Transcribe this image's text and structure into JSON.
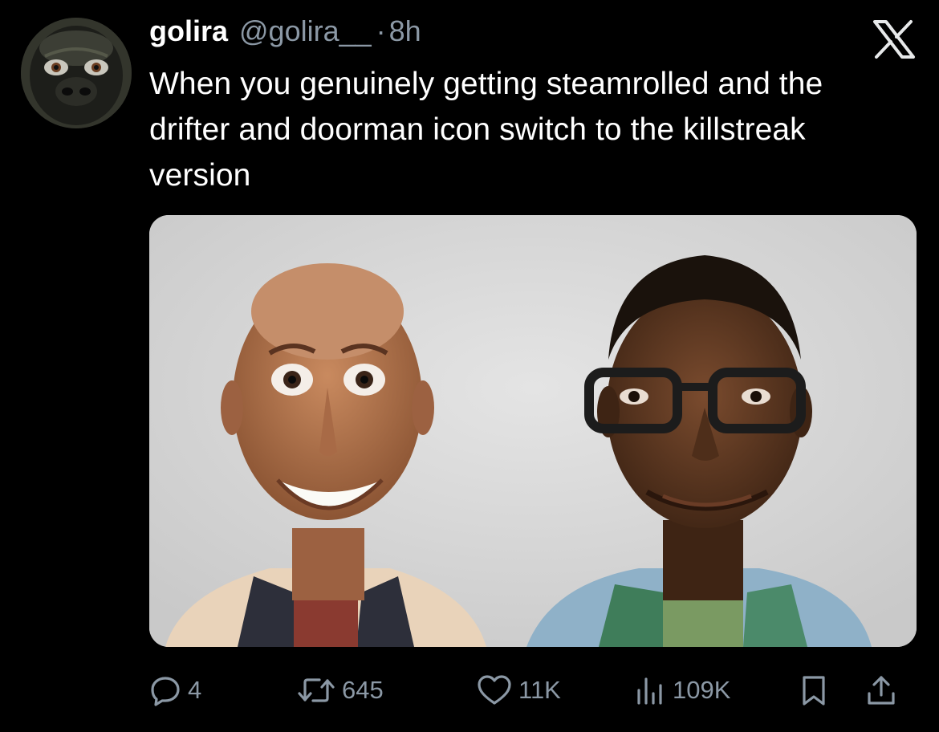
{
  "tweet": {
    "display_name": "golira",
    "handle": "@golira__",
    "separator": "·",
    "time": "8h",
    "text": "When you genuinely getting steamrolled and the drifter and doorman icon switch to the killstreak version"
  },
  "actions": {
    "replies": "4",
    "retweets": "645",
    "likes": "11K",
    "views": "109K"
  },
  "icons": {
    "reply": "reply-icon",
    "retweet": "retweet-icon",
    "like": "heart-icon",
    "views": "views-icon",
    "bookmark": "bookmark-icon",
    "share": "share-icon",
    "platform": "x-logo-icon"
  },
  "colors": {
    "background": "#000000",
    "text_primary": "#ffffff",
    "text_secondary": "#8b98a5"
  }
}
